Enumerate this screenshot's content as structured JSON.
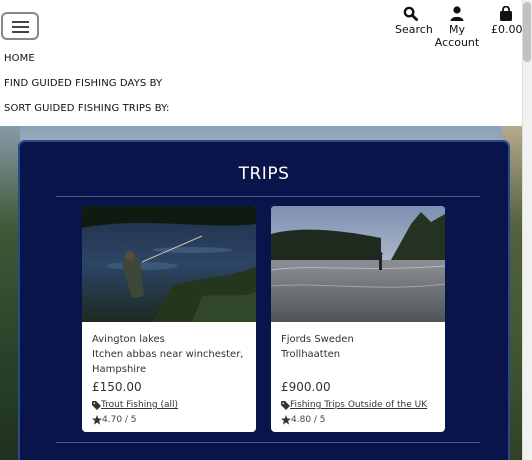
{
  "header": {
    "menu_button_label": "",
    "search_label": "Search",
    "account_label": "My Account",
    "basket_total": "£0.00"
  },
  "menu": {
    "items": [
      "HOME",
      "FIND GUIDED FISHING DAYS BY",
      "SORT GUIDED FISHING TRIPS BY:"
    ]
  },
  "trips": {
    "title": "TRIPS",
    "cards": [
      {
        "name": "Avington lakes",
        "location_line1": "Itchen abbas near winchester,",
        "location_line2": "Hampshire",
        "price": "£150.00",
        "category": "Trout Fishing (all)",
        "rating": "4.70 / 5"
      },
      {
        "name": "Fjords Sweden",
        "location_line1": "Trollhaatten",
        "location_line2": "",
        "price": "£900.00",
        "category": "Fishing Trips Outside of the UK",
        "rating": "4.80 / 5"
      }
    ]
  },
  "colors": {
    "panel_bg": "#09144a",
    "panel_border": "#2a4a8a",
    "card_bg": "#ffffff"
  },
  "icons": [
    "hamburger-icon",
    "search-icon",
    "user-icon",
    "shopping-bag-icon",
    "tag-icon",
    "star-icon"
  ]
}
